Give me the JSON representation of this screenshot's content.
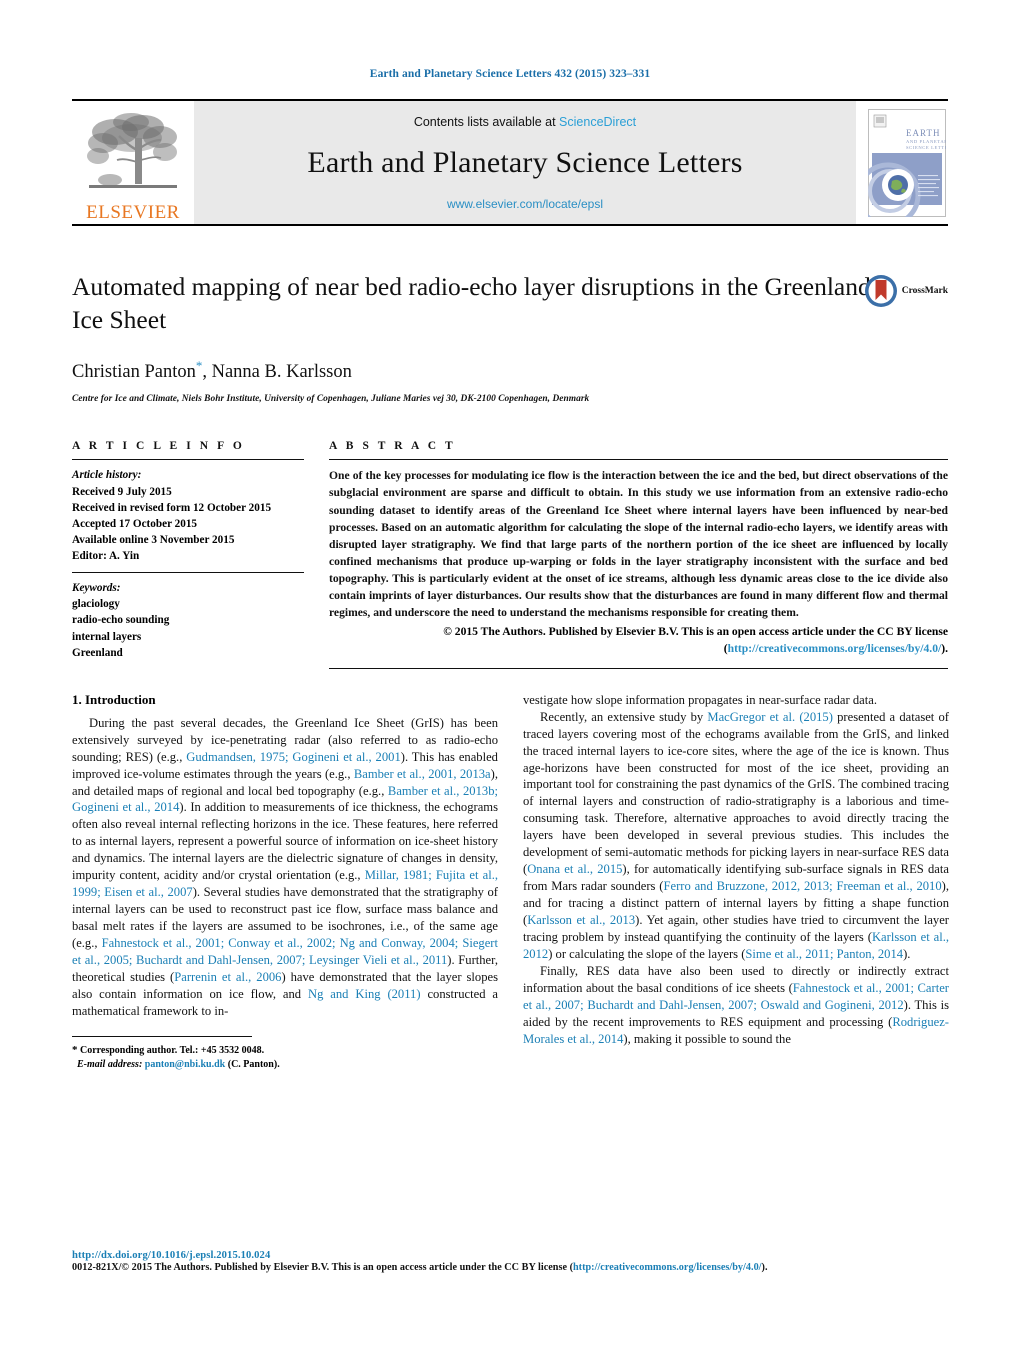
{
  "running_head": "Earth and Planetary Science Letters 432 (2015) 323–331",
  "journal_header": {
    "contents_prefix": "Contents lists available at ",
    "sciencedirect": "ScienceDirect",
    "journal_title": "Earth and Planetary Science Letters",
    "journal_url": "www.elsevier.com/locate/epsl",
    "publisher_wordmark": "ELSEVIER",
    "cover_title_line1": "EARTH",
    "cover_title_line2": "AND PLANETARY",
    "cover_title_line3": "SCIENCE LETTERS"
  },
  "article": {
    "title": "Automated mapping of near bed radio-echo layer disruptions in the Greenland Ice Sheet",
    "authors": "Christian Panton",
    "author_star": "*",
    "authors_rest": ", Nanna B. Karlsson",
    "affiliation": "Centre for Ice and Climate, Niels Bohr Institute, University of Copenhagen, Juliane Maries vej 30, DK-2100 Copenhagen, Denmark",
    "crossmark_label": "CrossMark"
  },
  "article_info": {
    "heading": "A R T I C L E   I N F O",
    "history_label": "Article history:",
    "history": [
      "Received 9 July 2015",
      "Received in revised form 12 October 2015",
      "Accepted 17 October 2015",
      "Available online 3 November 2015",
      "Editor: A. Yin"
    ],
    "keywords_label": "Keywords:",
    "keywords": [
      "glaciology",
      "radio-echo sounding",
      "internal layers",
      "Greenland"
    ]
  },
  "abstract": {
    "heading": "A B S T R A C T",
    "text": "One of the key processes for modulating ice flow is the interaction between the ice and the bed, but direct observations of the subglacial environment are sparse and difficult to obtain. In this study we use information from an extensive radio-echo sounding dataset to identify areas of the Greenland Ice Sheet where internal layers have been influenced by near-bed processes. Based on an automatic algorithm for calculating the slope of the internal radio-echo layers, we identify areas with disrupted layer stratigraphy. We find that large parts of the northern portion of the ice sheet are influenced by locally confined mechanisms that produce up-warping or folds in the layer stratigraphy inconsistent with the surface and bed topography. This is particularly evident at the onset of ice streams, although less dynamic areas close to the ice divide also contain imprints of layer disturbances. Our results show that the disturbances are found in many different flow and thermal regimes, and underscore the need to understand the mechanisms responsible for creating them.",
    "copyright_text": "© 2015 The Authors. Published by Elsevier B.V. This is an open access article under the CC BY license",
    "license_open": "(",
    "license_url": "http://creativecommons.org/licenses/by/4.0/",
    "license_close": ")."
  },
  "body": {
    "section1_title": "1. Introduction",
    "left_column": [
      {
        "indent": true,
        "runs": [
          {
            "t": "During the past several decades, the Greenland Ice Sheet (GrIS) has been extensively surveyed by ice-penetrating radar (also referred to as radio-echo sounding; RES) (e.g., "
          },
          {
            "t": "Gudmandsen, 1975; Gogineni et al., 2001",
            "link": true
          },
          {
            "t": "). This has enabled improved ice-volume estimates through the years (e.g., "
          },
          {
            "t": "Bamber et al., 2001, 2013a",
            "link": true
          },
          {
            "t": "), and detailed maps of regional and local bed topography (e.g., "
          },
          {
            "t": "Bamber et al., 2013b; Gogineni et al., 2014",
            "link": true
          },
          {
            "t": "). In addition to measurements of ice thickness, the echograms often also reveal internal reflecting horizons in the ice. These features, here referred to as internal layers, represent a powerful source of information on ice-sheet history and dynamics. The internal layers are the dielectric signature of changes in density, impurity content, acidity and/or crystal orientation (e.g., "
          },
          {
            "t": "Millar, 1981; Fujita et al., 1999; Eisen et al., 2007",
            "link": true
          },
          {
            "t": "). Several studies have demonstrated that the stratigraphy of internal layers can be used to reconstruct past ice flow, surface mass balance and basal melt rates if the layers are assumed to be isochrones, i.e., of the same age (e.g., "
          },
          {
            "t": "Fahnestock et al., 2001; Conway et al., 2002; Ng and Conway, 2004; Siegert et al., 2005; Buchardt and Dahl-Jensen, 2007; Leysinger Vieli et al., 2011",
            "link": true
          },
          {
            "t": "). Further, theoretical studies ("
          },
          {
            "t": "Parrenin et al., 2006",
            "link": true
          },
          {
            "t": ") have demonstrated that the layer slopes also contain information on ice flow, and "
          },
          {
            "t": "Ng and King (2011)",
            "link": true
          },
          {
            "t": " constructed a mathematical framework to in-"
          }
        ]
      }
    ],
    "right_column": [
      {
        "indent": false,
        "runs": [
          {
            "t": "vestigate how slope information propagates in near-surface radar data."
          }
        ]
      },
      {
        "indent": true,
        "runs": [
          {
            "t": "Recently, an extensive study by "
          },
          {
            "t": "MacGregor et al. (2015)",
            "link": true
          },
          {
            "t": " presented a dataset of traced layers covering most of the echograms available from the GrIS, and linked the traced internal layers to ice-core sites, where the age of the ice is known. Thus age-horizons have been constructed for most of the ice sheet, providing an important tool for constraining the past dynamics of the GrIS. The combined tracing of internal layers and construction of radio-stratigraphy is a laborious and time-consuming task. Therefore, alternative approaches to avoid directly tracing the layers have been developed in several previous studies. This includes the development of semi-automatic methods for picking layers in near-surface RES data ("
          },
          {
            "t": "Onana et al., 2015",
            "link": true
          },
          {
            "t": "), for automatically identifying sub-surface signals in RES data from Mars radar sounders ("
          },
          {
            "t": "Ferro and Bruzzone, 2012, 2013; Freeman et al., 2010",
            "link": true
          },
          {
            "t": "), and for tracing a distinct pattern of internal layers by fitting a shape function ("
          },
          {
            "t": "Karlsson et al., 2013",
            "link": true
          },
          {
            "t": "). Yet again, other studies have tried to circumvent the layer tracing problem by instead quantifying the continuity of the layers ("
          },
          {
            "t": "Karlsson et al., 2012",
            "link": true
          },
          {
            "t": ") or calculating the slope of the layers ("
          },
          {
            "t": "Sime et al., 2011; Panton, 2014",
            "link": true
          },
          {
            "t": ")."
          }
        ]
      },
      {
        "indent": true,
        "runs": [
          {
            "t": "Finally, RES data have also been used to directly or indirectly extract information about the basal conditions of ice sheets ("
          },
          {
            "t": "Fahnestock et al., 2001; Carter et al., 2007; Buchardt and Dahl-Jensen, 2007; Oswald and Gogineni, 2012",
            "link": true
          },
          {
            "t": "). This is aided by the recent improvements to RES equipment and processing ("
          },
          {
            "t": "Rodriguez-Morales et al., 2014",
            "link": true
          },
          {
            "t": "), making it possible to sound the"
          }
        ]
      }
    ]
  },
  "footnote": {
    "star": "*",
    "corresponding": "Corresponding author. Tel.: +45 3532 0048.",
    "email_label": "E-mail address:",
    "email": "panton@nbi.ku.dk",
    "email_suffix": "(C. Panton)."
  },
  "page_footer": {
    "doi": "http://dx.doi.org/10.1016/j.epsl.2015.10.024",
    "issn_prefix": "0012-821X/© 2015 The Authors. Published by Elsevier B.V. This is an open access article under the CC BY license (",
    "issn_license_url": "http://creativecommons.org/licenses/by/4.0/",
    "issn_suffix": ")."
  },
  "colors": {
    "link": "#1a7fb5",
    "sciencedirect": "#2a9fd6",
    "elsevier_orange": "#E87722",
    "header_band": "#e9e9e9",
    "crossmark_blue": "#3b6fa8",
    "crossmark_red": "#c0392b"
  }
}
